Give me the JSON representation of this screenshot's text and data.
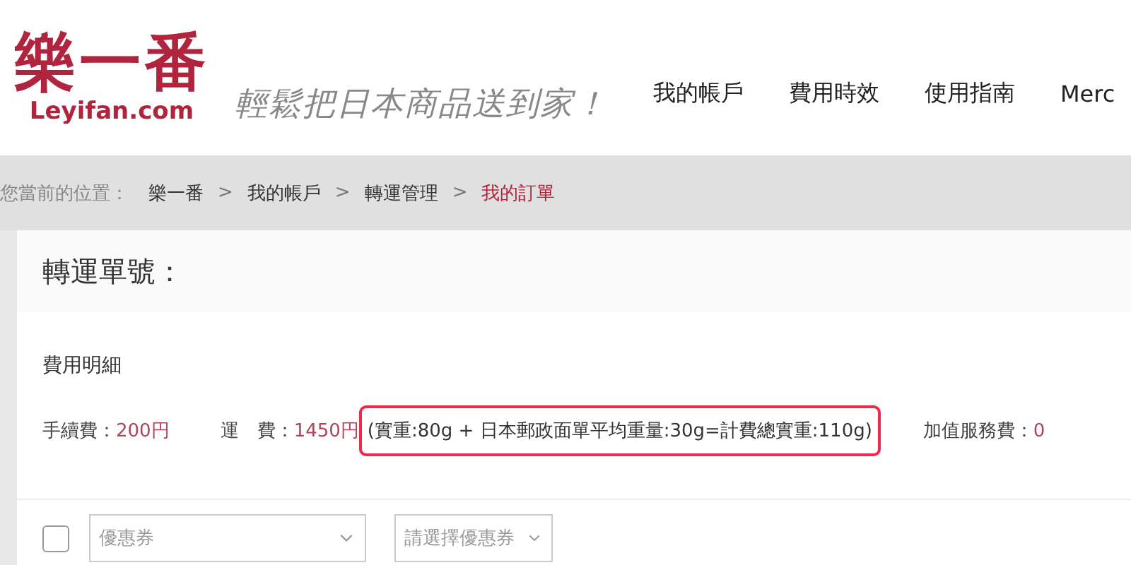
{
  "logo": {
    "mark": "樂一番",
    "domain": "Leyifan.com"
  },
  "tagline": "輕鬆把日本商品送到家！",
  "nav": [
    "我的帳戶",
    "費用時效",
    "使用指南",
    "Merc"
  ],
  "breadcrumb": {
    "label": "您當前的位置：",
    "items": [
      {
        "text": "樂一番",
        "selected": false
      },
      {
        "text": "我的帳戶",
        "selected": false
      },
      {
        "text": "轉運管理",
        "selected": false
      },
      {
        "text": "我的訂單",
        "selected": true
      }
    ],
    "separator": ">"
  },
  "order_title": "轉運單號：",
  "fees": {
    "heading": "費用明細",
    "items": [
      {
        "label": "手續費：",
        "value": "200円"
      },
      {
        "label": "運　費：",
        "value": "1450円",
        "note": "(實重:80g + 日本郵政面單平均重量:30g=計費總實重:110g)"
      },
      {
        "label": "加值服務費：",
        "value": "0"
      }
    ]
  },
  "coupon": {
    "checked": false,
    "select_placeholder": "優惠券",
    "picker": "請選擇優惠券"
  }
}
